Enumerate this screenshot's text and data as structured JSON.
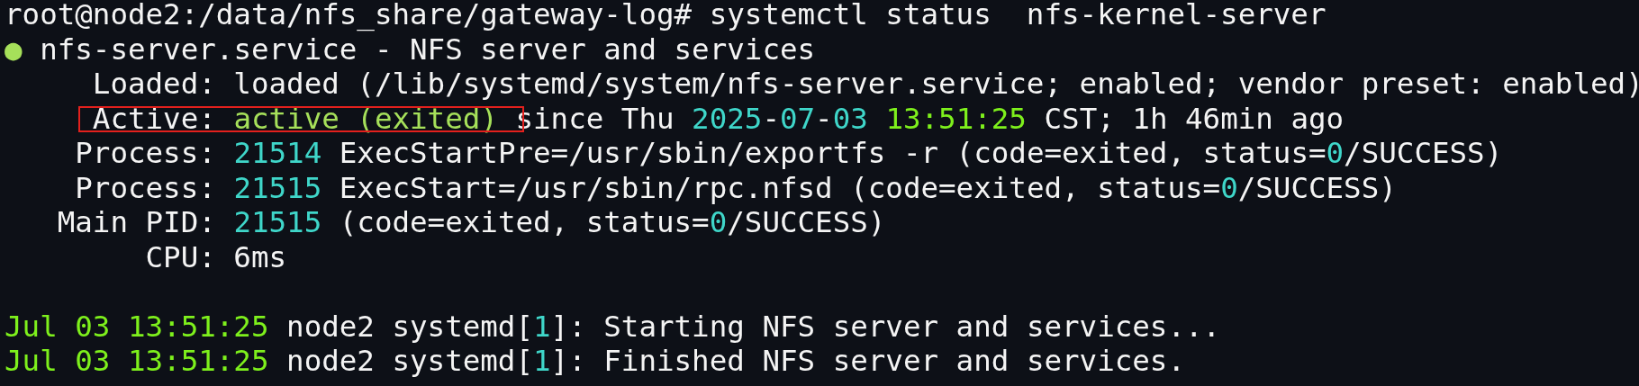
{
  "terminal": {
    "lines": [
      {
        "kind": "text",
        "segments": [
          {
            "text": "root@node2:/data/nfs_share/gateway-log# systemctl status  nfs-kernel-server",
            "kind": "plain"
          }
        ]
      },
      {
        "kind": "text",
        "segments": [
          {
            "text": "●",
            "kind": "green"
          },
          {
            "text": " nfs-server.service - NFS server and services",
            "kind": "plain"
          }
        ]
      },
      {
        "kind": "text",
        "segments": [
          {
            "text": "     Loaded: loaded (/lib/systemd/system/nfs-server.service; enabled; vendor preset: enabled)",
            "kind": "plain"
          }
        ]
      },
      {
        "kind": "text",
        "segments": [
          {
            "text": "     Active: ",
            "kind": "plain",
            "boxed": true
          },
          {
            "text": "active (exited)",
            "kind": "green",
            "boxed": true
          },
          {
            "text": " since Thu ",
            "kind": "plain"
          },
          {
            "text": "2025",
            "kind": "cyan"
          },
          {
            "text": "-",
            "kind": "plain"
          },
          {
            "text": "07",
            "kind": "cyan"
          },
          {
            "text": "-",
            "kind": "plain"
          },
          {
            "text": "03",
            "kind": "cyan"
          },
          {
            "text": " 13:51:25",
            "kind": "lime"
          },
          {
            "text": " CST; 1h 46min ago",
            "kind": "plain"
          }
        ]
      },
      {
        "kind": "text",
        "segments": [
          {
            "text": "    Process: ",
            "kind": "plain"
          },
          {
            "text": "21514",
            "kind": "cyan"
          },
          {
            "text": " ExecStartPre=/usr/sbin/exportfs -r (code=exited, status=",
            "kind": "plain"
          },
          {
            "text": "0",
            "kind": "cyan"
          },
          {
            "text": "/SUCCESS)",
            "kind": "plain"
          }
        ]
      },
      {
        "kind": "text",
        "segments": [
          {
            "text": "    Process: ",
            "kind": "plain"
          },
          {
            "text": "21515",
            "kind": "cyan"
          },
          {
            "text": " ExecStart=/usr/sbin/rpc.nfsd (code=exited, status=",
            "kind": "plain"
          },
          {
            "text": "0",
            "kind": "cyan"
          },
          {
            "text": "/SUCCESS)",
            "kind": "plain"
          }
        ]
      },
      {
        "kind": "text",
        "segments": [
          {
            "text": "   Main PID: ",
            "kind": "plain"
          },
          {
            "text": "21515",
            "kind": "cyan"
          },
          {
            "text": " (code=exited, status=",
            "kind": "plain"
          },
          {
            "text": "0",
            "kind": "cyan"
          },
          {
            "text": "/SUCCESS)",
            "kind": "plain"
          }
        ]
      },
      {
        "kind": "text",
        "segments": [
          {
            "text": "        CPU: 6ms",
            "kind": "plain"
          }
        ]
      },
      {
        "kind": "blank"
      },
      {
        "kind": "text",
        "segments": [
          {
            "text": "Jul 03 13:51:25",
            "kind": "lime"
          },
          {
            "text": " node2 systemd[",
            "kind": "plain"
          },
          {
            "text": "1",
            "kind": "cyan"
          },
          {
            "text": "]: Starting NFS server and services...",
            "kind": "plain"
          }
        ]
      },
      {
        "kind": "text",
        "segments": [
          {
            "text": "Jul 03 13:51:25",
            "kind": "lime"
          },
          {
            "text": " node2 systemd[",
            "kind": "plain"
          },
          {
            "text": "1",
            "kind": "cyan"
          },
          {
            "text": "]: Finished NFS server and services.",
            "kind": "plain"
          }
        ]
      }
    ]
  }
}
